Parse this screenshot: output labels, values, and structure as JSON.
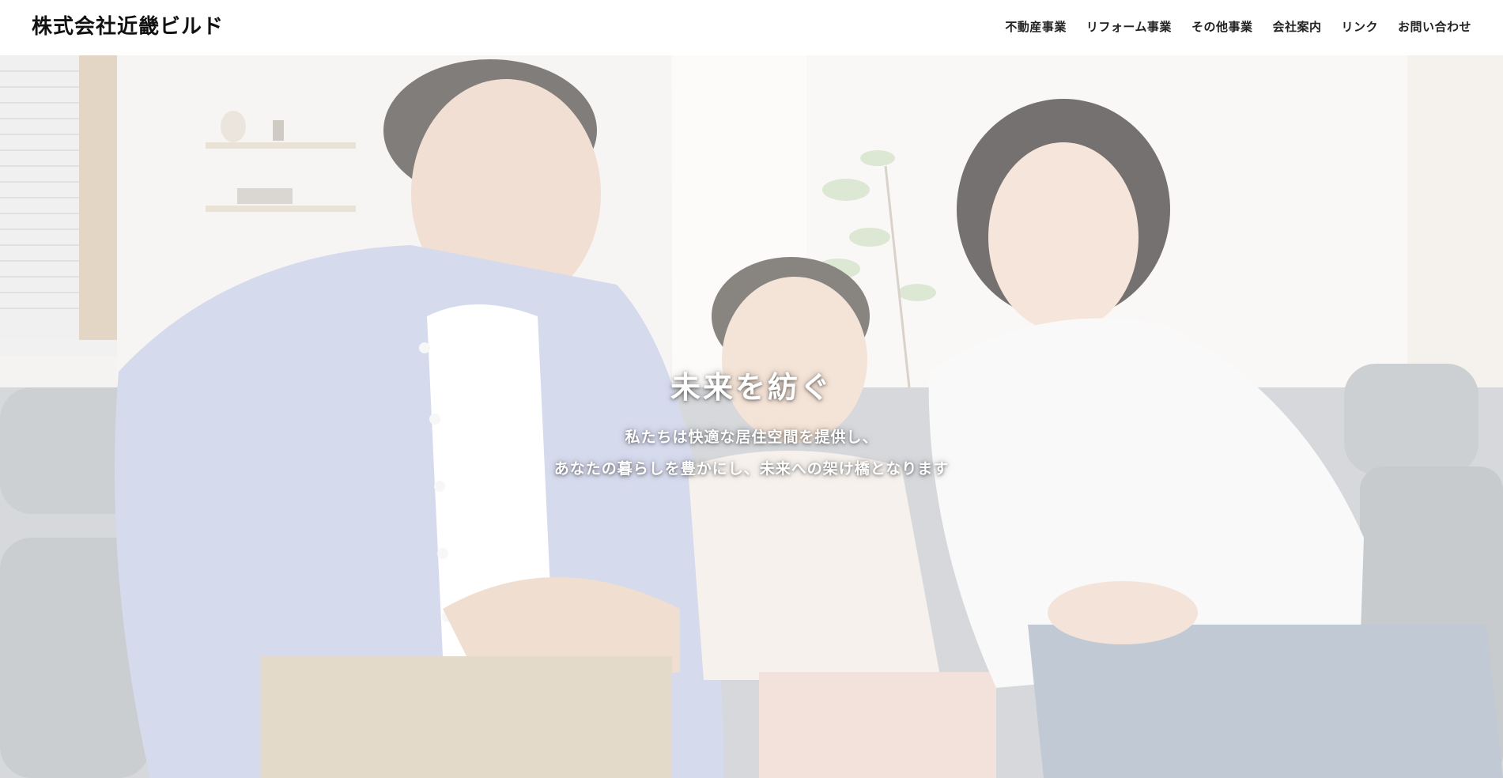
{
  "header": {
    "logo": "株式会社近畿ビルド",
    "nav": [
      {
        "label": "不動産事業"
      },
      {
        "label": "リフォーム事業"
      },
      {
        "label": "その他事業"
      },
      {
        "label": "会社案内"
      },
      {
        "label": "リンク"
      },
      {
        "label": "お問い合わせ"
      }
    ]
  },
  "hero": {
    "title": "未来を紡ぐ",
    "lines": [
      "私たちは快適な居住空間を提供し、",
      "あなたの暮らしを豊かにし、未来への架け橋となります"
    ]
  }
}
